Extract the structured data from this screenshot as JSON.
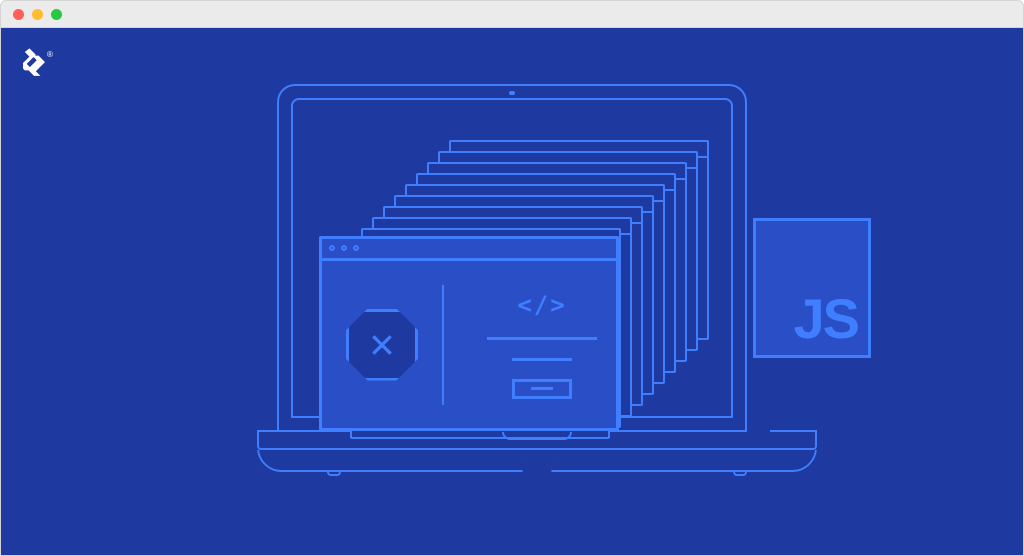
{
  "logo": {
    "trademark": "®"
  },
  "illustration": {
    "code_symbol": "</>",
    "js_label": "JS"
  }
}
